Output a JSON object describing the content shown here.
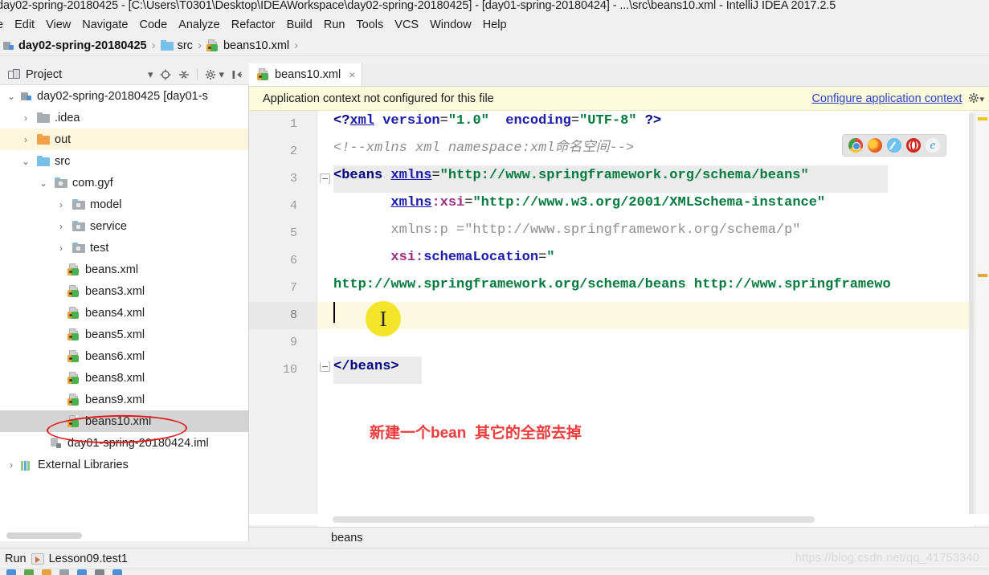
{
  "window": {
    "title": "day02-spring-20180425 - [C:\\Users\\T0301\\Desktop\\IDEAWorkspace\\day02-spring-20180425] - [day01-spring-20180424] - ...\\src\\beans10.xml - IntelliJ IDEA 2017.2.5"
  },
  "menubar": {
    "items": [
      {
        "label": "e",
        "accel": ""
      },
      {
        "label": "Edit",
        "accel": "E"
      },
      {
        "label": "View",
        "accel": "V"
      },
      {
        "label": "Navigate",
        "accel": "N"
      },
      {
        "label": "Code",
        "accel": "C"
      },
      {
        "label": "Analyze",
        "accel": "y"
      },
      {
        "label": "Refactor",
        "accel": "R"
      },
      {
        "label": "Build",
        "accel": "B"
      },
      {
        "label": "Run",
        "accel": "u"
      },
      {
        "label": "Tools",
        "accel": "T"
      },
      {
        "label": "VCS",
        "accel": "S"
      },
      {
        "label": "Window",
        "accel": "W"
      },
      {
        "label": "Help",
        "accel": "H"
      }
    ]
  },
  "breadcrumb": {
    "items": [
      "day02-spring-20180425",
      "src",
      "beans10.xml"
    ],
    "separator": "›"
  },
  "project_panel": {
    "title": "Project",
    "tools": [
      "chevron-down-icon",
      "locate-icon",
      "collapse-all-icon",
      "settings-gear-icon",
      "hide-panel-icon"
    ],
    "tree": [
      {
        "label": "day02-spring-20180425 [day01-s",
        "indent": 0,
        "arrow": "⌄",
        "icon": "module-icon",
        "state": "normal"
      },
      {
        "label": ".idea",
        "indent": 1,
        "arrow": "›",
        "icon": "folder-gray-icon",
        "state": "normal"
      },
      {
        "label": "out",
        "indent": 1,
        "arrow": "›",
        "icon": "folder-orange-icon",
        "state": "highlight"
      },
      {
        "label": "src",
        "indent": 1,
        "arrow": "⌄",
        "icon": "folder-blue-icon",
        "state": "normal"
      },
      {
        "label": "com.gyf",
        "indent": 2,
        "arrow": "⌄",
        "icon": "package-icon",
        "state": "normal"
      },
      {
        "label": "model",
        "indent": 3,
        "arrow": "›",
        "icon": "package-icon",
        "state": "normal"
      },
      {
        "label": "service",
        "indent": 3,
        "arrow": "›",
        "icon": "package-icon",
        "state": "normal"
      },
      {
        "label": "test",
        "indent": 3,
        "arrow": "›",
        "icon": "package-icon",
        "state": "normal"
      },
      {
        "label": "beans.xml",
        "indent": 3,
        "arrow": "",
        "icon": "xml-file-icon",
        "state": "normal"
      },
      {
        "label": "beans3.xml",
        "indent": 3,
        "arrow": "",
        "icon": "xml-file-icon",
        "state": "normal"
      },
      {
        "label": "beans4.xml",
        "indent": 3,
        "arrow": "",
        "icon": "xml-file-icon",
        "state": "normal"
      },
      {
        "label": "beans5.xml",
        "indent": 3,
        "arrow": "",
        "icon": "xml-file-icon",
        "state": "normal"
      },
      {
        "label": "beans6.xml",
        "indent": 3,
        "arrow": "",
        "icon": "xml-file-icon",
        "state": "normal"
      },
      {
        "label": "beans8.xml",
        "indent": 3,
        "arrow": "",
        "icon": "xml-file-icon",
        "state": "normal"
      },
      {
        "label": "beans9.xml",
        "indent": 3,
        "arrow": "",
        "icon": "xml-file-icon",
        "state": "normal"
      },
      {
        "label": "beans10.xml",
        "indent": 3,
        "arrow": "",
        "icon": "xml-file-icon",
        "state": "selected"
      },
      {
        "label": "day01-spring-20180424.iml",
        "indent": 2,
        "arrow": "",
        "icon": "iml-file-icon",
        "state": "normal"
      },
      {
        "label": "External Libraries",
        "indent": 0,
        "arrow": "›",
        "icon": "library-icon",
        "state": "normal"
      }
    ]
  },
  "editor": {
    "tab": {
      "label": "beans10.xml",
      "close": "×"
    },
    "banner": {
      "message": "Application context not configured for this file",
      "link": "Configure application context",
      "gear": "⚙"
    },
    "line_numbers": [
      "1",
      "2",
      "3",
      "4",
      "5",
      "6",
      "7",
      "8",
      "9",
      "10"
    ],
    "current_line": 8,
    "lines": [
      "<?xml version=\"1.0\" encoding=\"UTF-8\" ?>",
      "<!--xmlns xml namespace:xml命名空间-->",
      "<beans xmlns=\"http://www.springframework.org/schema/beans\"",
      "       xmlns:xsi=\"http://www.w3.org/2001/XMLSchema-instance\"",
      "       xmlns:p =\"http://www.springframework.org/schema/p\"",
      "       xsi:schemaLocation=\"",
      "http://www.springframework.org/schema/beans http://www.springframewo",
      "",
      "",
      "</beans>"
    ],
    "footer_breadcrumb": "beans",
    "browsers": [
      "chrome-icon",
      "firefox-icon",
      "safari-icon",
      "opera-icon",
      "internet-explorer-icon"
    ]
  },
  "annotation": {
    "note": "新建一个bean  其它的全部去掉",
    "note_color": "#ef3b3b",
    "ellipse_target": "beans10.xml"
  },
  "statusbar": {
    "run_label": "Run",
    "run_config": "Lesson09.test1"
  },
  "watermark": "https://blog.csdn.net/qq_41753340"
}
